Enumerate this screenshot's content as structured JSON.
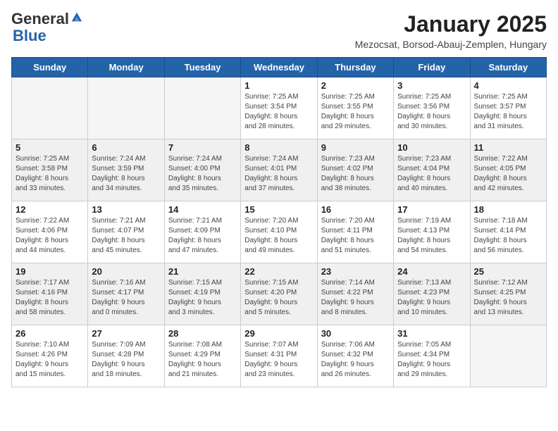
{
  "logo": {
    "general": "General",
    "blue": "Blue"
  },
  "title": "January 2025",
  "subtitle": "Mezocsat, Borsod-Abauj-Zemplen, Hungary",
  "weekdays": [
    "Sunday",
    "Monday",
    "Tuesday",
    "Wednesday",
    "Thursday",
    "Friday",
    "Saturday"
  ],
  "weeks": [
    [
      {
        "day": "",
        "info": ""
      },
      {
        "day": "",
        "info": ""
      },
      {
        "day": "",
        "info": ""
      },
      {
        "day": "1",
        "info": "Sunrise: 7:25 AM\nSunset: 3:54 PM\nDaylight: 8 hours\nand 28 minutes."
      },
      {
        "day": "2",
        "info": "Sunrise: 7:25 AM\nSunset: 3:55 PM\nDaylight: 8 hours\nand 29 minutes."
      },
      {
        "day": "3",
        "info": "Sunrise: 7:25 AM\nSunset: 3:56 PM\nDaylight: 8 hours\nand 30 minutes."
      },
      {
        "day": "4",
        "info": "Sunrise: 7:25 AM\nSunset: 3:57 PM\nDaylight: 8 hours\nand 31 minutes."
      }
    ],
    [
      {
        "day": "5",
        "info": "Sunrise: 7:25 AM\nSunset: 3:58 PM\nDaylight: 8 hours\nand 33 minutes."
      },
      {
        "day": "6",
        "info": "Sunrise: 7:24 AM\nSunset: 3:59 PM\nDaylight: 8 hours\nand 34 minutes."
      },
      {
        "day": "7",
        "info": "Sunrise: 7:24 AM\nSunset: 4:00 PM\nDaylight: 8 hours\nand 35 minutes."
      },
      {
        "day": "8",
        "info": "Sunrise: 7:24 AM\nSunset: 4:01 PM\nDaylight: 8 hours\nand 37 minutes."
      },
      {
        "day": "9",
        "info": "Sunrise: 7:23 AM\nSunset: 4:02 PM\nDaylight: 8 hours\nand 38 minutes."
      },
      {
        "day": "10",
        "info": "Sunrise: 7:23 AM\nSunset: 4:04 PM\nDaylight: 8 hours\nand 40 minutes."
      },
      {
        "day": "11",
        "info": "Sunrise: 7:22 AM\nSunset: 4:05 PM\nDaylight: 8 hours\nand 42 minutes."
      }
    ],
    [
      {
        "day": "12",
        "info": "Sunrise: 7:22 AM\nSunset: 4:06 PM\nDaylight: 8 hours\nand 44 minutes."
      },
      {
        "day": "13",
        "info": "Sunrise: 7:21 AM\nSunset: 4:07 PM\nDaylight: 8 hours\nand 45 minutes."
      },
      {
        "day": "14",
        "info": "Sunrise: 7:21 AM\nSunset: 4:09 PM\nDaylight: 8 hours\nand 47 minutes."
      },
      {
        "day": "15",
        "info": "Sunrise: 7:20 AM\nSunset: 4:10 PM\nDaylight: 8 hours\nand 49 minutes."
      },
      {
        "day": "16",
        "info": "Sunrise: 7:20 AM\nSunset: 4:11 PM\nDaylight: 8 hours\nand 51 minutes."
      },
      {
        "day": "17",
        "info": "Sunrise: 7:19 AM\nSunset: 4:13 PM\nDaylight: 8 hours\nand 54 minutes."
      },
      {
        "day": "18",
        "info": "Sunrise: 7:18 AM\nSunset: 4:14 PM\nDaylight: 8 hours\nand 56 minutes."
      }
    ],
    [
      {
        "day": "19",
        "info": "Sunrise: 7:17 AM\nSunset: 4:16 PM\nDaylight: 8 hours\nand 58 minutes."
      },
      {
        "day": "20",
        "info": "Sunrise: 7:16 AM\nSunset: 4:17 PM\nDaylight: 9 hours\nand 0 minutes."
      },
      {
        "day": "21",
        "info": "Sunrise: 7:15 AM\nSunset: 4:19 PM\nDaylight: 9 hours\nand 3 minutes."
      },
      {
        "day": "22",
        "info": "Sunrise: 7:15 AM\nSunset: 4:20 PM\nDaylight: 9 hours\nand 5 minutes."
      },
      {
        "day": "23",
        "info": "Sunrise: 7:14 AM\nSunset: 4:22 PM\nDaylight: 9 hours\nand 8 minutes."
      },
      {
        "day": "24",
        "info": "Sunrise: 7:13 AM\nSunset: 4:23 PM\nDaylight: 9 hours\nand 10 minutes."
      },
      {
        "day": "25",
        "info": "Sunrise: 7:12 AM\nSunset: 4:25 PM\nDaylight: 9 hours\nand 13 minutes."
      }
    ],
    [
      {
        "day": "26",
        "info": "Sunrise: 7:10 AM\nSunset: 4:26 PM\nDaylight: 9 hours\nand 15 minutes."
      },
      {
        "day": "27",
        "info": "Sunrise: 7:09 AM\nSunset: 4:28 PM\nDaylight: 9 hours\nand 18 minutes."
      },
      {
        "day": "28",
        "info": "Sunrise: 7:08 AM\nSunset: 4:29 PM\nDaylight: 9 hours\nand 21 minutes."
      },
      {
        "day": "29",
        "info": "Sunrise: 7:07 AM\nSunset: 4:31 PM\nDaylight: 9 hours\nand 23 minutes."
      },
      {
        "day": "30",
        "info": "Sunrise: 7:06 AM\nSunset: 4:32 PM\nDaylight: 9 hours\nand 26 minutes."
      },
      {
        "day": "31",
        "info": "Sunrise: 7:05 AM\nSunset: 4:34 PM\nDaylight: 9 hours\nand 29 minutes."
      },
      {
        "day": "",
        "info": ""
      }
    ]
  ]
}
